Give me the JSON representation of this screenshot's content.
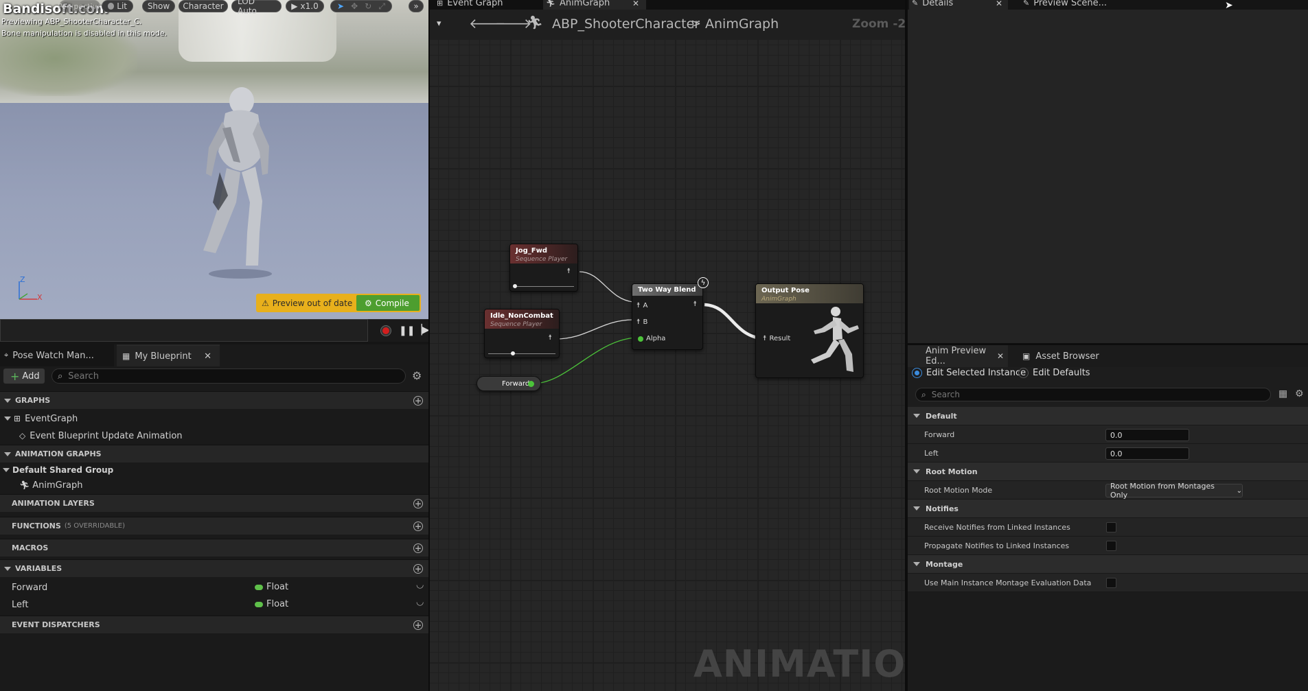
{
  "viewport": {
    "watermark": "Bandisoft.com",
    "view_mode": "Perspective",
    "lit": "Lit",
    "show": "Show",
    "character": "Character",
    "lod": "LOD Auto",
    "play_rate": "x1.0",
    "preview_msg1": "Previewing ABP_ShooterCharacter_C.",
    "preview_msg2": "Bone manipulation is disabled in this mode.",
    "axis_z": "Z",
    "axis_x": "X",
    "preview_out_of_date": "Preview out of date",
    "compile": "Compile"
  },
  "left": {
    "tab_pose_watch": "Pose Watch Man...",
    "tab_my_blueprint": "My Blueprint",
    "add_label": "Add",
    "search_placeholder": "Search",
    "graphs": "GRAPHS",
    "event_graph": "EventGraph",
    "event_update": "Event Blueprint Update Animation",
    "animation_graphs": "ANIMATION GRAPHS",
    "default_group": "Default Shared Group",
    "anim_graph": "AnimGraph",
    "animation_layers": "ANIMATION LAYERS",
    "functions": "FUNCTIONS",
    "functions_note": "(5 OVERRIDABLE)",
    "macros": "MACROS",
    "variables": "VARIABLES",
    "vars": [
      {
        "name": "Forward",
        "type": "Float"
      },
      {
        "name": "Left",
        "type": "Float"
      }
    ],
    "event_dispatchers": "EVENT DISPATCHERS"
  },
  "graph": {
    "tab_event_graph": "Event Graph",
    "tab_anim_graph": "AnimGraph",
    "breadcrumb_bp": "ABP_ShooterCharacter",
    "breadcrumb_sep": ">",
    "breadcrumb_graph": "AnimGraph",
    "zoom": "Zoom -2",
    "watermark": "ANIMATION",
    "nodes": {
      "jog_title": "Jog_Fwd",
      "jog_sub": "Sequence Player",
      "idle_title": "Idle_NonCombat",
      "idle_sub": "Sequence Player",
      "blend_title": "Two Way Blend",
      "pin_a": "A",
      "pin_b": "B",
      "pin_alpha": "Alpha",
      "forward": "Forward",
      "output_title": "Output Pose",
      "output_sub": "AnimGraph",
      "result": "Result"
    }
  },
  "right": {
    "tab_details": "Details",
    "tab_preview_scene": "Preview Scene...",
    "tab_anim_preview": "Anim Preview Ed...",
    "tab_asset_browser": "Asset Browser",
    "radio_selected": "Edit Selected Instance",
    "radio_defaults": "Edit Defaults",
    "search_placeholder": "Search",
    "sect_default": "Default",
    "forward_label": "Forward",
    "forward_value": "0.0",
    "left_label": "Left",
    "left_value": "0.0",
    "sect_root_motion": "Root Motion",
    "root_motion_mode_label": "Root Motion Mode",
    "root_motion_mode_value": "Root Motion from Montages Only",
    "sect_notifies": "Notifies",
    "receive_notifies": "Receive Notifies from Linked Instances",
    "propagate_notifies": "Propagate Notifies to Linked Instances",
    "sect_montage": "Montage",
    "use_main_montage": "Use Main Instance Montage Evaluation Data"
  }
}
